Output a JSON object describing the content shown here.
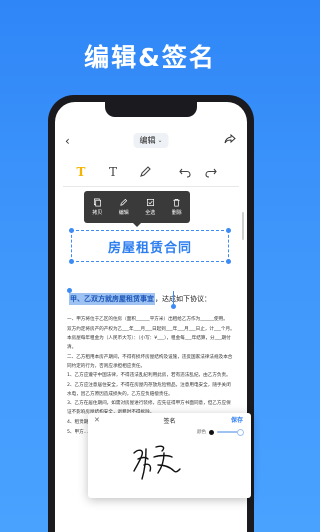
{
  "headline": "编辑&签名",
  "topbar": {
    "back_icon": "back-arrow-icon",
    "mode_label": "编辑",
    "mode_chevron": "◆",
    "share_icon": "share-icon"
  },
  "toolbar": {
    "text_bold_glyph": "T",
    "text_glyph": "T",
    "pen_icon": "pen-icon",
    "undo_icon": "undo-icon",
    "redo_icon": "redo-icon"
  },
  "context_menu": {
    "items": [
      {
        "label": "拷贝",
        "icon": "copy-icon"
      },
      {
        "label": "编辑",
        "icon": "edit-icon"
      },
      {
        "label": "全选",
        "icon": "select-all-icon"
      },
      {
        "label": "删除",
        "icon": "delete-icon"
      }
    ]
  },
  "document": {
    "title": "房屋租赁合同",
    "selected_text": "甲、乙双方就房屋租赁事宜",
    "selected_suffix": "，达成如下协议：",
    "paragraphs": [
      "一、甲方将位于乙区的住房（面积______平方米）出租给乙方作为______使用。",
      "双方约定将房产的产权为乙___年___月___日起到___年___月___日止，计___个月。",
      "本房屋每年租金为（人民币大写）：（小写：¥___），租金每___年结算，分___期付清。",
      "二、乙方租用本房产期间，不得有损坏房屋结构及设施，违反国家法律法规及本合同约定的行为，否则应承担相应责任。",
      "1、乙方应遵守中国法律，不得违法乱纪利用此房，若有违法乱纪，由乙方负责。",
      "2、乙方应注意居住安全，不得在房屋内存放危险物品，注意用电安全，随手关闭水电，因乙方原因造成损失的，乙方应负赔偿责任。",
      "3、乙方在居住期间，如需对房屋进行装修，应先征得甲方书面同意，但乙方应保证不影响房屋结构安全，退租时不得拆除。",
      "4、租赁期满后，乙方需继续租用的，应提前一个月通知甲方。",
      "5、甲方..."
    ]
  },
  "signature_panel": {
    "close_icon": "close-icon",
    "title": "签名",
    "save_label": "保存",
    "color_label": "颜色",
    "color": "#111111"
  },
  "colors": {
    "accent": "#2d7ef0",
    "background_top": "#2f86f7",
    "selection": "#9ec3f3"
  }
}
